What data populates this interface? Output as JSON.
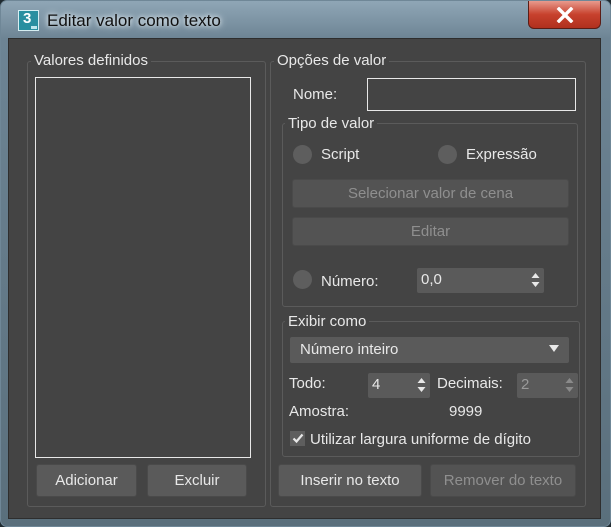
{
  "window": {
    "title": "Editar valor como texto",
    "app_icon_glyph": "3",
    "close_icon": "close-x-icon"
  },
  "defined_values": {
    "group_label": "Valores definidos",
    "items": [],
    "add_label": "Adicionar",
    "delete_label": "Excluir"
  },
  "value_options": {
    "group_label": "Opções de valor",
    "name_label": "Nome:",
    "name_value": "",
    "value_type": {
      "group_label": "Tipo de valor",
      "script_label": "Script",
      "expression_label": "Expressão",
      "select_scene_label": "Selecionar valor de cena",
      "edit_label": "Editar",
      "number_label": "Número:",
      "number_value": "0,0"
    },
    "display_as": {
      "group_label": "Exibir como",
      "format_value": "Número inteiro",
      "all_label": "Todo:",
      "all_value": "4",
      "decimals_label": "Decimais:",
      "decimals_value": "2",
      "sample_label": "Amostra:",
      "sample_value": "9999",
      "uniform_width_label": "Utilizar largura uniforme de dígito",
      "uniform_width_checked": true
    }
  },
  "footer": {
    "insert_label": "Inserir no texto",
    "remove_label": "Remover do texto"
  },
  "colors": {
    "dialog_bg": "#444444",
    "close_button": "#c7412d"
  }
}
